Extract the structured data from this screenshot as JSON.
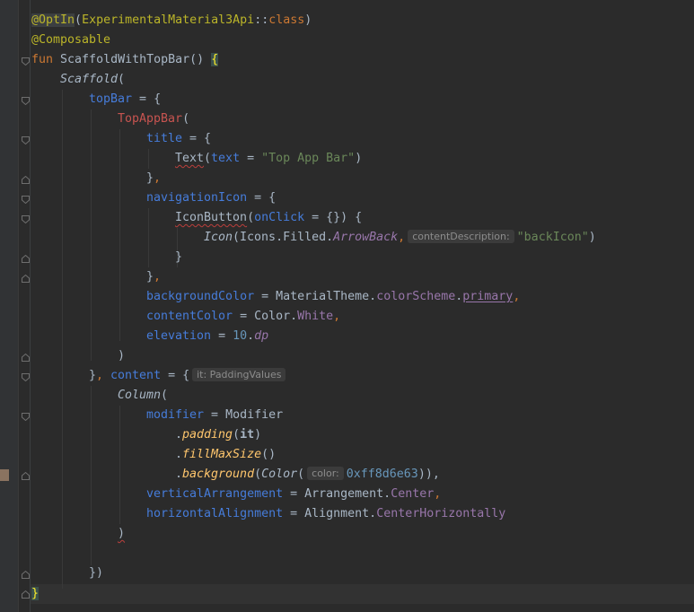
{
  "code": {
    "l1": {
      "a": "@OptIn",
      "b": "(",
      "c": "ExperimentalMaterial3Api",
      "d": "::",
      "e": "class",
      "f": ")"
    },
    "l2": {
      "a": "@Composable"
    },
    "l3": {
      "a": "fun",
      "b": " ScaffoldWithTopBar",
      "c": "() ",
      "d": "{"
    },
    "l4": {
      "a": "Scaffold",
      "b": "("
    },
    "l5": {
      "a": "topBar",
      "b": " = {"
    },
    "l6": {
      "a": "TopAppBar",
      "b": "("
    },
    "l7": {
      "a": "title",
      "b": " = {"
    },
    "l8": {
      "a": "Text",
      "b": "(",
      "c": "text",
      "d": " = ",
      "e": "\"Top App Bar\"",
      "f": ")"
    },
    "l9": {
      "a": "}",
      ",": ","
    },
    "l10": {
      "a": "navigationIcon",
      "b": " = {"
    },
    "l11": {
      "a": "IconButton",
      "b": "(",
      "c": "onClick",
      "d": " = {}) {"
    },
    "l12": {
      "a": "Icon",
      "b": "(Icons.Filled.",
      "c": "ArrowBack",
      "d": ",",
      "hint": "contentDescription:",
      "e": "\"backIcon\"",
      "f": ")"
    },
    "l13": {
      "a": "}"
    },
    "l14": {
      "a": "}",
      ",": ","
    },
    "l15": {
      "a": "backgroundColor",
      "b": " = MaterialTheme.",
      "c": "colorScheme",
      "d": ".",
      "e": "primary",
      "f": ","
    },
    "l16": {
      "a": "contentColor",
      "b": " = Color.",
      "c": "White",
      "d": ","
    },
    "l17": {
      "a": "elevation",
      "b": " = ",
      "c": "10",
      "d": ".",
      "e": "dp"
    },
    "l18": {
      "a": ")"
    },
    "l19": {
      "a": "}",
      ",": ", ",
      "c": "content",
      "d": " = {",
      "hint": "it: PaddingValues"
    },
    "l20": {
      "a": "Column",
      "b": "("
    },
    "l21": {
      "a": "modifier",
      "b": " = Modifier"
    },
    "l22": {
      "a": ".",
      "b": "padding",
      "c": "(",
      "d": "it",
      "e": ")"
    },
    "l23": {
      "a": ".",
      "b": "fillMaxSize",
      "c": "()"
    },
    "l24": {
      "a": ".",
      "b": "background",
      "c": "(",
      "d": "Color",
      "e": "(",
      "hint": "color:",
      "f": "0xff8d6e63",
      "g": ")),"
    },
    "l25": {
      "a": "verticalArrangement",
      "b": " = Arrangement.",
      "c": "Center",
      "d": ","
    },
    "l26": {
      "a": "horizontalAlignment",
      "b": " = Alignment.",
      "c": "CenterHorizontally"
    },
    "l27": {
      "a": ")"
    },
    "l29": {
      "a": "})"
    },
    "l30": {
      "a": "}"
    }
  },
  "colors": {
    "background": "#2b2b2b",
    "gutter": "#313335",
    "keyword": "#cc7832",
    "annotation": "#bbb529",
    "function": "#ffc66d",
    "string": "#6a8759",
    "number": "#6897bb",
    "property": "#9876aa",
    "parameter": "#467cda"
  }
}
